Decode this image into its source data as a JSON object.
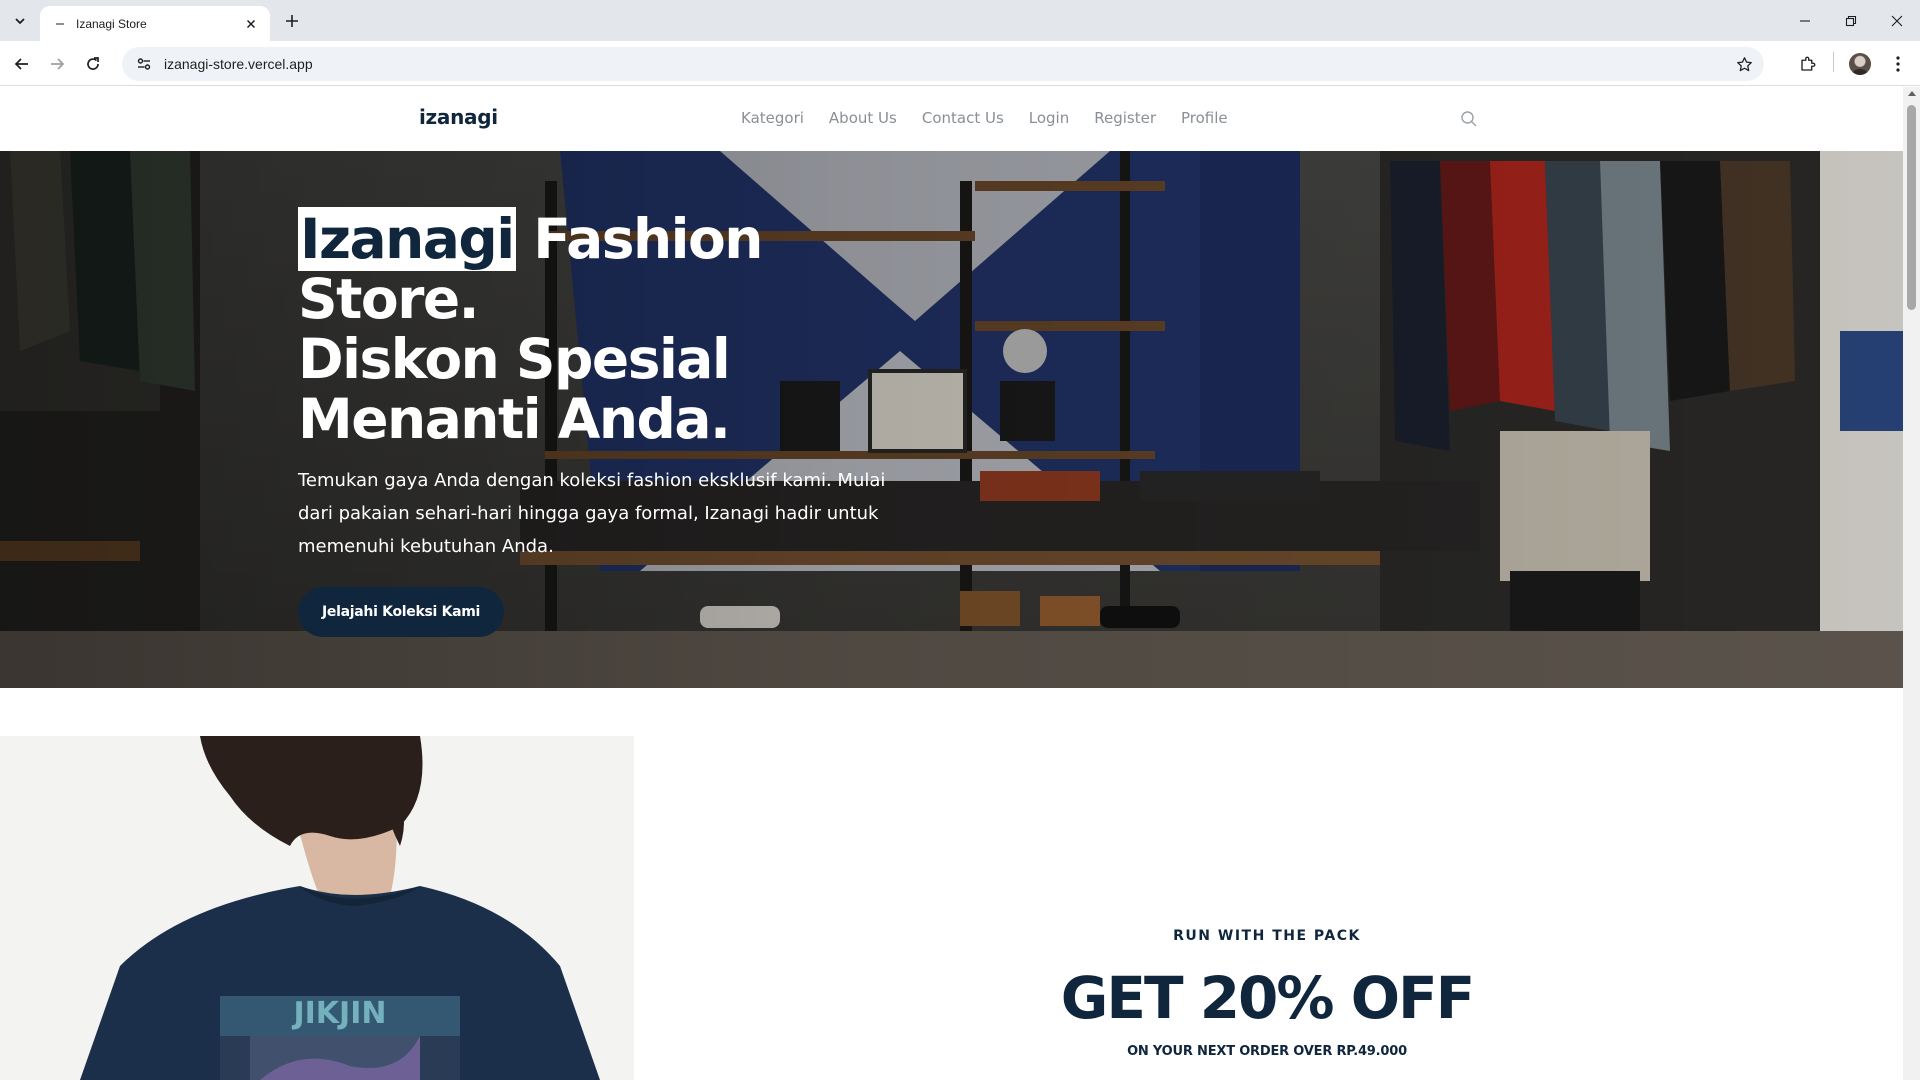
{
  "browser": {
    "tab_title": "Izanagi Store",
    "url": "izanagi-store.vercel.app"
  },
  "site": {
    "logo": "izanagi",
    "nav": [
      "Kategori",
      "About Us",
      "Contact Us",
      "Login",
      "Register",
      "Profile"
    ]
  },
  "hero": {
    "title_highlight": "Izanagi",
    "title_rest_1": " Fashion",
    "title_line_2": "Store.",
    "title_line_3": "Diskon Spesial",
    "title_line_4": "Menanti Anda.",
    "description": "Temukan gaya Anda dengan koleksi fashion eksklusif kami. Mulai dari pakaian sehari-hari hingga gaya formal, Izanagi hadir untuk memenuhi kebutuhan Anda.",
    "cta": "Jelajahi Koleksi Kami"
  },
  "promo": {
    "eyebrow": "RUN WITH THE PACK",
    "headline": "GET 20% OFF",
    "subline": "ON YOUR NEXT ORDER OVER RP.49.000"
  },
  "colors": {
    "brand_navy": "#10263d",
    "nav_gray": "#8a8f96"
  }
}
